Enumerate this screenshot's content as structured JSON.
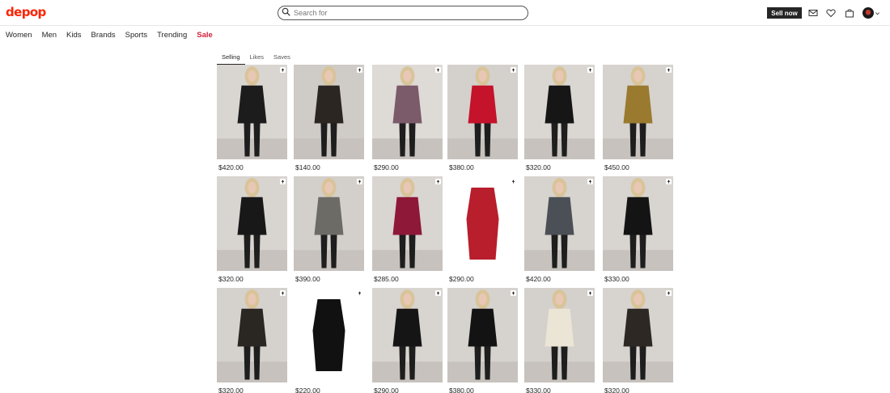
{
  "header": {
    "logo": "depop",
    "search_placeholder": "Search for",
    "sell_label": "Sell now",
    "icons": [
      "mail-icon",
      "heart-icon",
      "bag-icon"
    ]
  },
  "nav": {
    "items": [
      "Women",
      "Men",
      "Kids",
      "Brands",
      "Sports",
      "Trending",
      "Sale"
    ]
  },
  "tabs": [
    {
      "label": "Selling",
      "active": true
    },
    {
      "label": "Likes",
      "active": false
    },
    {
      "label": "Saves",
      "active": false
    }
  ],
  "products": [
    {
      "price": "$420.00",
      "desc": "sheer black blouse with black pants",
      "bg": "#d9d6d2",
      "garment": "#1c1c1c"
    },
    {
      "price": "$140.00",
      "desc": "dark brown blazer with black pants",
      "bg": "#cfcbc7",
      "garment": "#2b2622"
    },
    {
      "price": "$290.00",
      "desc": "sequin slip midi dress",
      "bg": "#dedad6",
      "garment": "#7b5a6a"
    },
    {
      "price": "$380.00",
      "desc": "red leather blazer",
      "bg": "#d4d0cc",
      "garment": "#c4132b"
    },
    {
      "price": "$320.00",
      "desc": "black blazer with mini skirt",
      "bg": "#dad6d2",
      "garment": "#161616"
    },
    {
      "price": "$450.00",
      "desc": "gold patterned jacket and skirt set",
      "bg": "#d6d2ce",
      "garment": "#9a7a2e"
    },
    {
      "price": "$320.00",
      "desc": "black blazer with mini skirt",
      "bg": "#d8d4d0",
      "garment": "#181818"
    },
    {
      "price": "$390.00",
      "desc": "grey wrap dress",
      "bg": "#d3cfcb",
      "garment": "#6d6b66"
    },
    {
      "price": "$285.00",
      "desc": "red sequin strapless dress",
      "bg": "#d9d5d1",
      "garment": "#8e1838"
    },
    {
      "price": "$290.00",
      "desc": "floral print bodysuit",
      "bg": "#ffffff",
      "garment": "#b81e2c"
    },
    {
      "price": "$420.00",
      "desc": "blazer with grey trousers",
      "bg": "#d7d3cf",
      "garment": "#4b4f56"
    },
    {
      "price": "$330.00",
      "desc": "black sleeveless midi dress",
      "bg": "#d8d4d0",
      "garment": "#141414"
    },
    {
      "price": "$320.00",
      "desc": "black leather jacket and skirt",
      "bg": "#d5d1cd",
      "garment": "#2a2622"
    },
    {
      "price": "$220.00",
      "desc": "black satin corset top",
      "bg": "#ffffff",
      "garment": "#111111"
    },
    {
      "price": "$290.00",
      "desc": "black slip mini dress",
      "bg": "#d8d4d0",
      "garment": "#151515"
    },
    {
      "price": "$380.00",
      "desc": "black turtleneck dress",
      "bg": "#d6d2ce",
      "garment": "#131313"
    },
    {
      "price": "$330.00",
      "desc": "cream blazer with white pants",
      "bg": "#d4d0cc",
      "garment": "#ebe5d6"
    },
    {
      "price": "$320.00",
      "desc": "dark blazer with leather skirt",
      "bg": "#d7d3cf",
      "garment": "#2d2824"
    }
  ]
}
